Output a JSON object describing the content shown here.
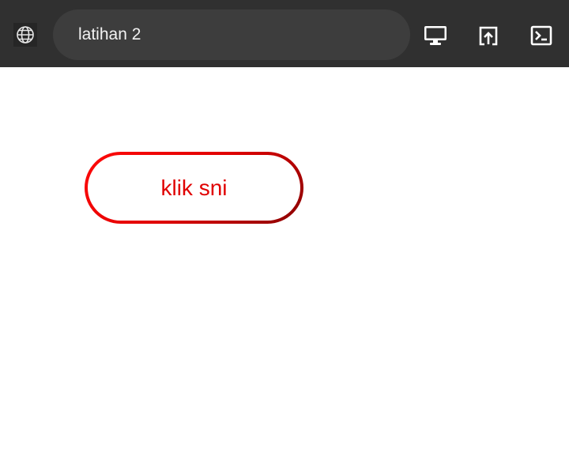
{
  "toolbar": {
    "address_text": "latihan 2",
    "icons": {
      "site": "globe-icon",
      "display": "monitor-icon",
      "open_external": "open-in-new-window-icon",
      "console": "terminal-icon"
    },
    "colors": {
      "background": "#303030",
      "address_bg": "#3d3d3d",
      "text": "#f2f2f2"
    }
  },
  "main": {
    "button_label": "klik sni",
    "colors": {
      "button_text": "#e00000",
      "border_start": "#ff0a0a",
      "border_end": "#8a0000"
    }
  }
}
